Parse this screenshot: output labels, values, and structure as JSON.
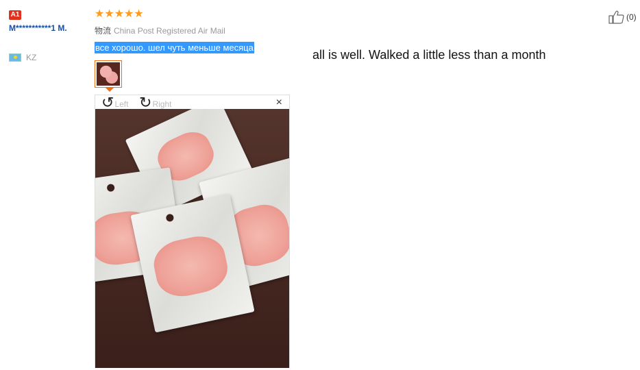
{
  "user": {
    "badge": "A1",
    "name": "M***********1 M.",
    "country_code": "KZ"
  },
  "review": {
    "stars": "★★★★★",
    "shipping_label": "物流",
    "shipping_method": "China Post Registered Air Mail",
    "text": "все хорошо. шел чуть меньше месяца",
    "translation": "all is well. Walked a little less than a month",
    "helpful_count": "(0)"
  },
  "viewer": {
    "rotate_left": "Left",
    "rotate_right": "Right",
    "close": "×"
  },
  "colors": {
    "badge": "#e0301e",
    "username": "#1a4fa0",
    "stars": "#ff9a1a",
    "selection": "#3399ff",
    "thumb_border": "#e8731a"
  }
}
